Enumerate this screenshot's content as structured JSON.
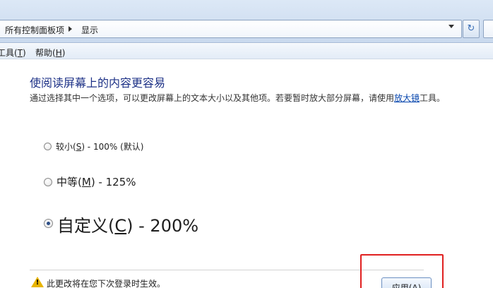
{
  "address_bar": {
    "crumbs": [
      "所有控制面板项",
      "显示"
    ],
    "refresh_icon": "refresh-icon"
  },
  "menu": {
    "items": [
      {
        "label": "工具(",
        "hotkey": "T",
        "suffix": ")"
      },
      {
        "label": "帮助(",
        "hotkey": "H",
        "suffix": ")"
      }
    ]
  },
  "content": {
    "heading": "使阅读屏幕上的内容更容易",
    "description_before": "通过选择其中一个选项，可以更改屏幕上的文本大小以及其他项。若要暂时放大部分屏幕，请使用",
    "magnifier_link": "放大镜",
    "description_after": "工具。",
    "options": [
      {
        "pre": "较小(",
        "hotkey": "S",
        "post": ") - 100% (默认)",
        "selected": false
      },
      {
        "pre": "中等(",
        "hotkey": "M",
        "post": ") - 125%",
        "selected": false
      },
      {
        "pre": "自定义(",
        "hotkey": "C",
        "post": ") - 200%",
        "selected": true
      }
    ],
    "notice": "此更改将在您下次登录时生效。",
    "apply_button": "应用(A)"
  },
  "colors": {
    "heading": "#1e3287",
    "link": "#0645ad",
    "highlight_box": "#e02020",
    "warning": "#e8b400"
  }
}
